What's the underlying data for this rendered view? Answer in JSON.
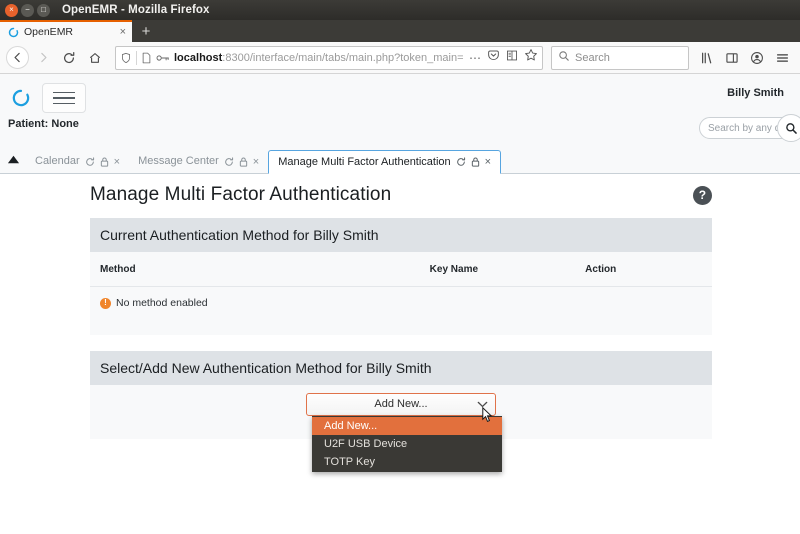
{
  "window": {
    "title": "OpenEMR - Mozilla Firefox",
    "close_glyph": "×",
    "minimize_glyph": "−",
    "maximize_glyph": "□"
  },
  "browser": {
    "tab": {
      "label": "OpenEMR",
      "favicon_name": "openemr-favicon",
      "close_glyph": "×"
    },
    "new_tab_glyph": "+",
    "nav": {
      "back_glyph": "←",
      "forward_glyph": "→",
      "reload_glyph": "↻",
      "home_glyph": "⌂"
    },
    "urlbar": {
      "host": "localhost",
      "path": ":8300/interface/main/tabs/main.php?token_main=",
      "shield_icon": "tracking-protection-shield-icon",
      "page_icon": "page-info-icon",
      "permissions_icon": "permissions-key-icon",
      "overflow_glyph": "⋯",
      "pocket_glyph": "♥",
      "reader_glyph": "☷",
      "bookmark_glyph": "☆"
    },
    "search": {
      "placeholder": "Search",
      "icon": "search-icon"
    },
    "toolbar_right": {
      "library_glyph": "‖",
      "sidebar_glyph": "◫",
      "account_glyph": "●",
      "menu_glyph": "☰"
    }
  },
  "emr": {
    "logo_name": "openemr-circle-logo",
    "menu_toggle_name": "hamburger-menu-button",
    "user_name": "Billy Smith",
    "patient_label": "Patient: None",
    "search": {
      "placeholder": "Search by any demographics",
      "visible_text": "Search by any de",
      "icon": "search-icon"
    },
    "tabs": [
      {
        "label": "Calendar",
        "active": false
      },
      {
        "label": "Message Center",
        "active": false
      },
      {
        "label": "Manage Multi Factor Authentication",
        "active": true
      }
    ],
    "tab_icons": {
      "refresh": "refresh-icon",
      "lock": "lock-icon",
      "close": "×"
    },
    "caret_glyph": "▲"
  },
  "page": {
    "title": "Manage Multi Factor Authentication",
    "help_icon": "help-question-icon",
    "help_glyph": "?",
    "current_panel": {
      "heading": "Current Authentication Method for Billy Smith",
      "columns": [
        "Method",
        "Key Name",
        "Action"
      ],
      "empty_message": "No method enabled",
      "empty_icon": "warning-exclamation-icon",
      "empty_icon_glyph": "!"
    },
    "select_panel": {
      "heading": "Select/Add New Authentication Method for Billy Smith",
      "select": {
        "name": "authentication-method-select",
        "selected_value": "Add New...",
        "caret_icon": "chevron-down-icon",
        "expanded": true,
        "options": [
          {
            "label": "Add New...",
            "selected": true
          },
          {
            "label": "U2F USB Device",
            "selected": false
          },
          {
            "label": "TOTP Key",
            "selected": false
          }
        ]
      }
    }
  },
  "colors": {
    "accent_orange": "#e2703d",
    "select_border": "#e0734a",
    "dropdown_bg": "#3a3935",
    "panel_head": "#dee2e6",
    "warn_orange": "#f0852b",
    "active_tab_border": "#57a5e0",
    "firefox_tab_top": "#e66000"
  }
}
